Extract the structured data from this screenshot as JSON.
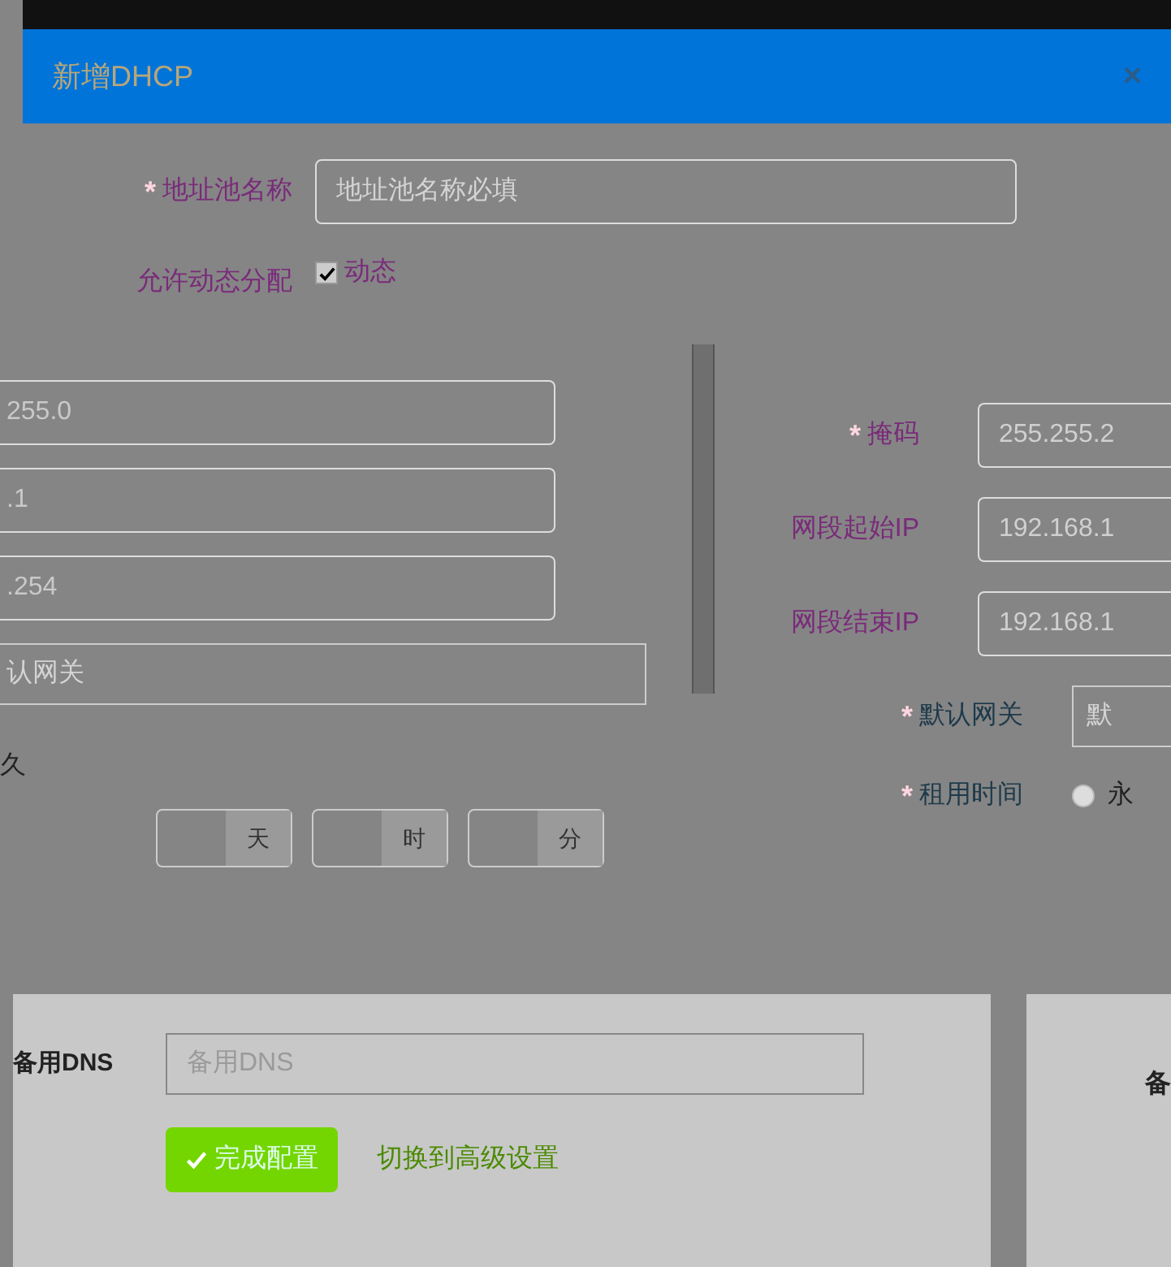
{
  "dialog": {
    "title": "新增DHCP",
    "close": "×"
  },
  "top_form": [
    {
      "kind": "input",
      "marker": "*",
      "label": "地址池名称",
      "placeholder": "地址池名称必填"
    },
    {
      "kind": "checkbox",
      "label": "允许动态分配",
      "option": "动态",
      "checked": true
    }
  ],
  "left_fields": [
    {
      "value": "255.0"
    },
    {
      "value": ".1"
    },
    {
      "value": ".254"
    }
  ],
  "left_gateway": {
    "placeholder": "认网关"
  },
  "left_lease": {
    "text": "久",
    "units": [
      "天",
      "时",
      "分"
    ]
  },
  "right_fields": [
    {
      "marker": "*",
      "label": "掩码",
      "value": "255.255.2"
    },
    {
      "label": "网段起始IP",
      "value": "192.168.1"
    },
    {
      "label": "网段结束IP",
      "value": "192.168.1"
    }
  ],
  "right_gateway": {
    "marker": "*",
    "label": "默认网关",
    "placeholder": "默"
  },
  "right_lease": {
    "marker": "*",
    "label": "租用时间",
    "option": "永",
    "selected": false
  },
  "bottom": {
    "dns_label": "备用DNS",
    "dns_placeholder": "备用DNS",
    "submit": "完成配置",
    "link": "切换到高级设置",
    "side_text": "备"
  }
}
